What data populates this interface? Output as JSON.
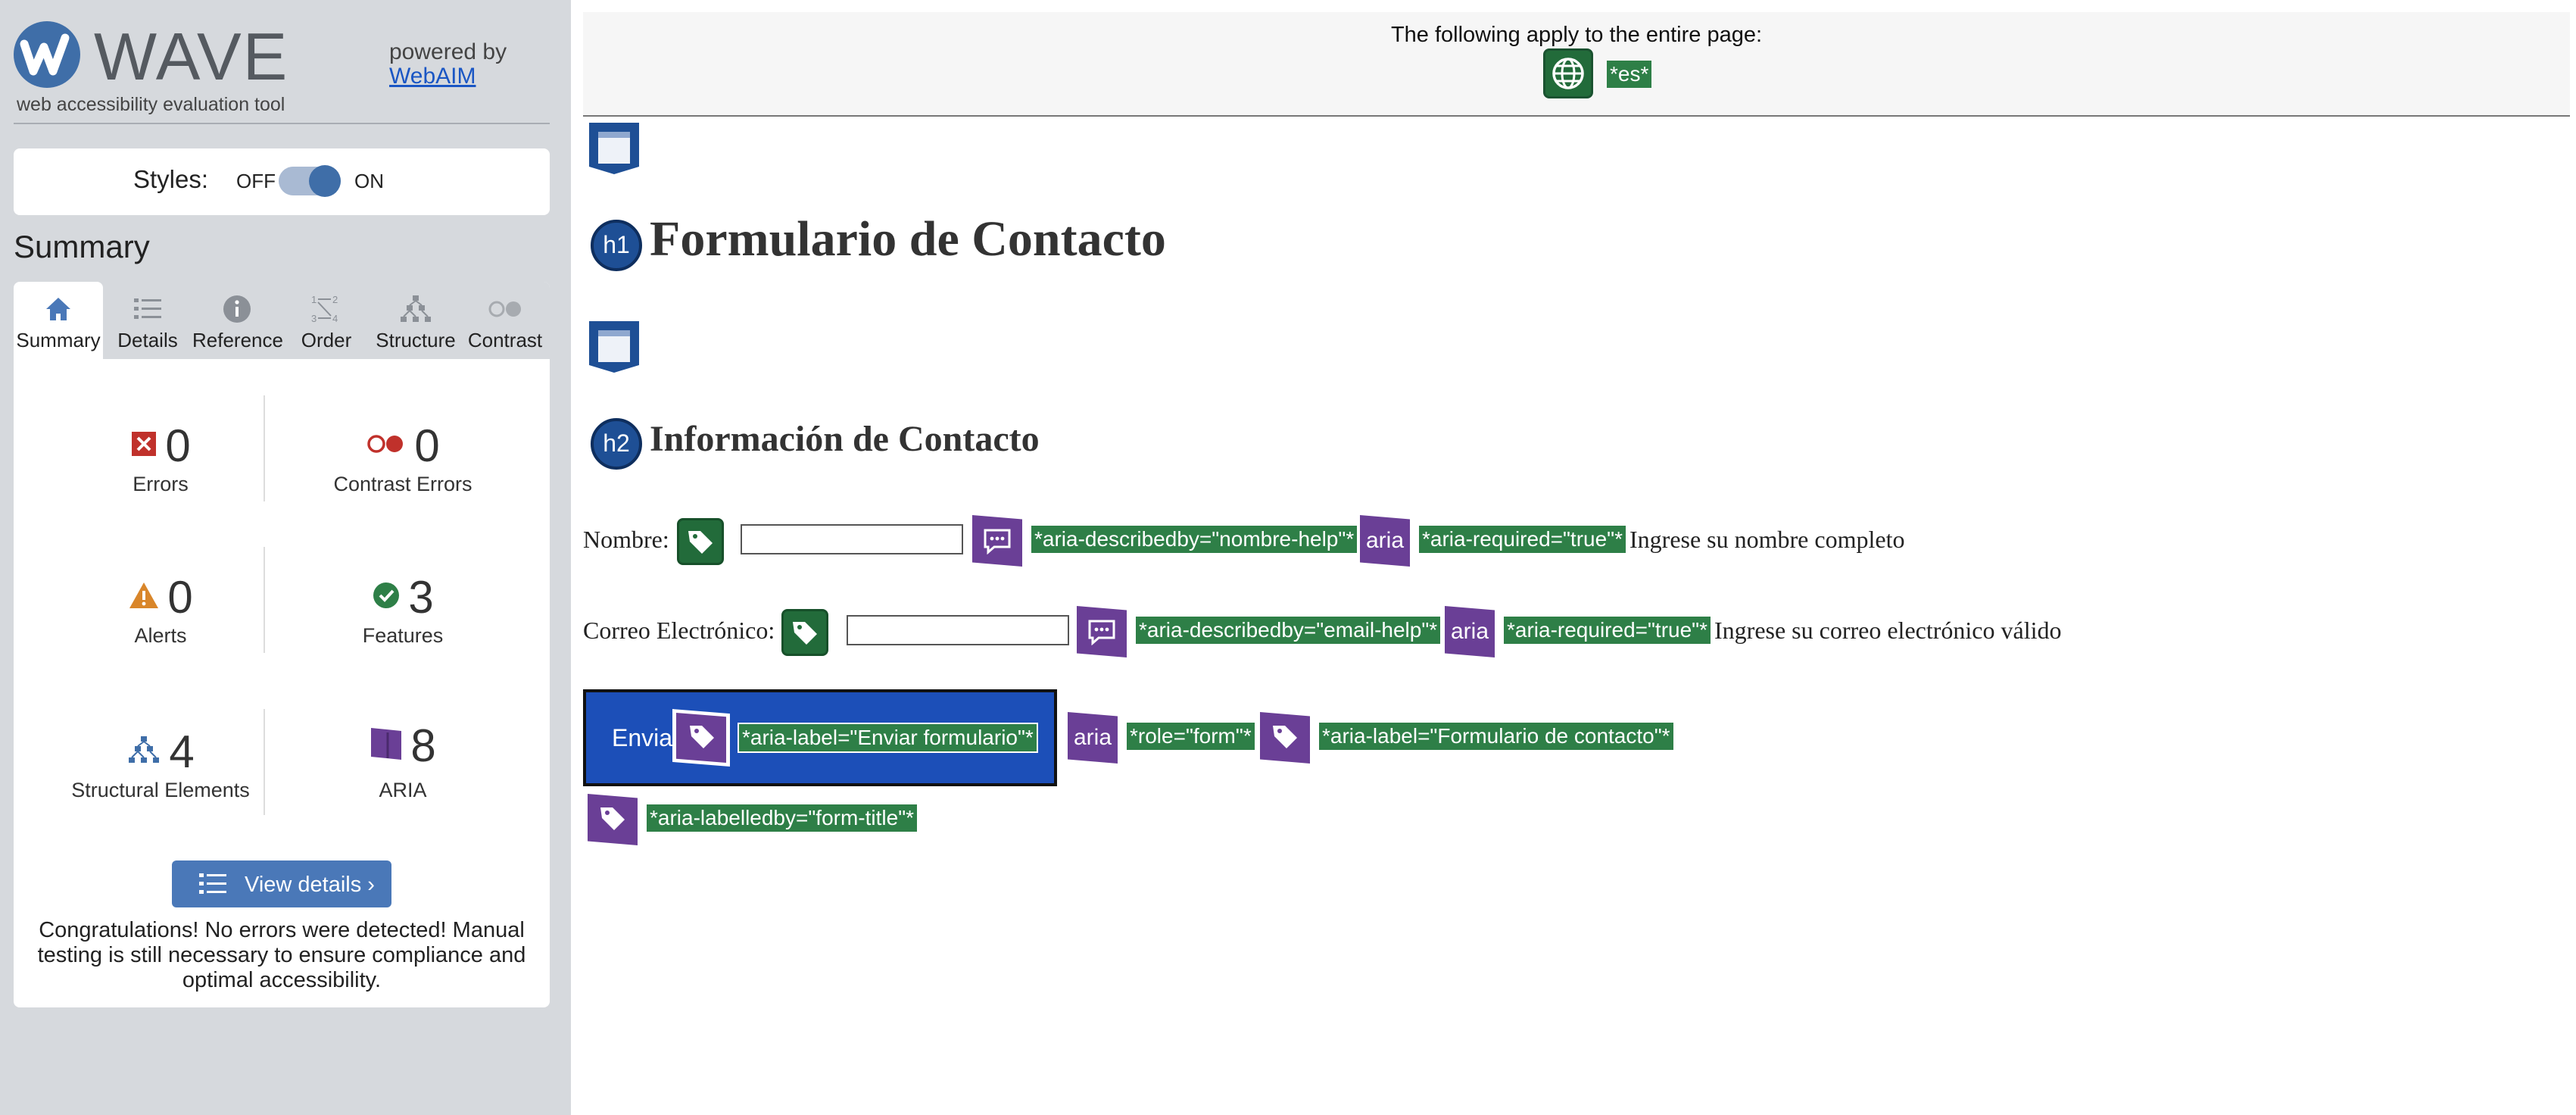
{
  "wave": {
    "name": "WAVE",
    "tagline": "web accessibility evaluation tool",
    "powered_by": "powered by",
    "webaim": "WebAIM"
  },
  "styles": {
    "label": "Styles:",
    "off": "OFF",
    "on": "ON",
    "state": "on"
  },
  "summary": {
    "heading": "Summary",
    "tabs": [
      {
        "label": "Summary",
        "icon": "home-icon"
      },
      {
        "label": "Details",
        "icon": "list-icon"
      },
      {
        "label": "Reference",
        "icon": "info-icon"
      },
      {
        "label": "Order",
        "icon": "order-icon"
      },
      {
        "label": "Structure",
        "icon": "hierarchy-icon"
      },
      {
        "label": "Contrast",
        "icon": "contrast-icon"
      }
    ],
    "active_tab": "Summary",
    "metrics": {
      "errors": {
        "count": "0",
        "label": "Errors"
      },
      "contrast": {
        "count": "0",
        "label": "Contrast Errors"
      },
      "alerts": {
        "count": "0",
        "label": "Alerts"
      },
      "features": {
        "count": "3",
        "label": "Features"
      },
      "structural": {
        "count": "4",
        "label": "Structural Elements"
      },
      "aria": {
        "count": "8",
        "label": "ARIA"
      }
    },
    "view_details": "View details ›",
    "congrats": "Congratulations! No errors were detected! Manual testing is still necessary to ensure compliance and optimal accessibility."
  },
  "page": {
    "banner": "The following apply to the entire page:",
    "lang_tag": "*es*",
    "h1_badge": "h1",
    "h1": "Formulario de Contacto",
    "h2_badge": "h2",
    "h2": "Información de Contacto",
    "nombre": {
      "label": "Nombre:",
      "value": "",
      "describedby": "*aria-describedby=\"nombre-help\"*",
      "aria_badge": "aria",
      "required": "*aria-required=\"true\"*",
      "help": "Ingrese su nombre completo"
    },
    "email": {
      "label": "Correo Electrónico:",
      "value": "",
      "describedby": "*aria-describedby=\"email-help\"*",
      "aria_badge": "aria",
      "required": "*aria-required=\"true\"*",
      "help": "Ingrese su correo electrónico válido"
    },
    "submit": {
      "label": "Enviar",
      "aria_label": "*aria-label=\"Enviar formulario\"*"
    },
    "form": {
      "aria_badge": "aria",
      "role": "*role=\"form\"*",
      "aria_label": "*aria-label=\"Formulario de contacto\"*",
      "labelledby": "*aria-labelledby=\"form-title\"*"
    }
  },
  "colors": {
    "sidebar_bg": "#d6d9dd",
    "wave_blue": "#3f6ea8",
    "feature_green": "#226b3a",
    "aria_purple": "#6a3f96",
    "heading_badge": "#1e4f95",
    "error_red": "#c0312b",
    "alert_orange": "#d9862a",
    "submit_blue": "#1c4fb8"
  }
}
